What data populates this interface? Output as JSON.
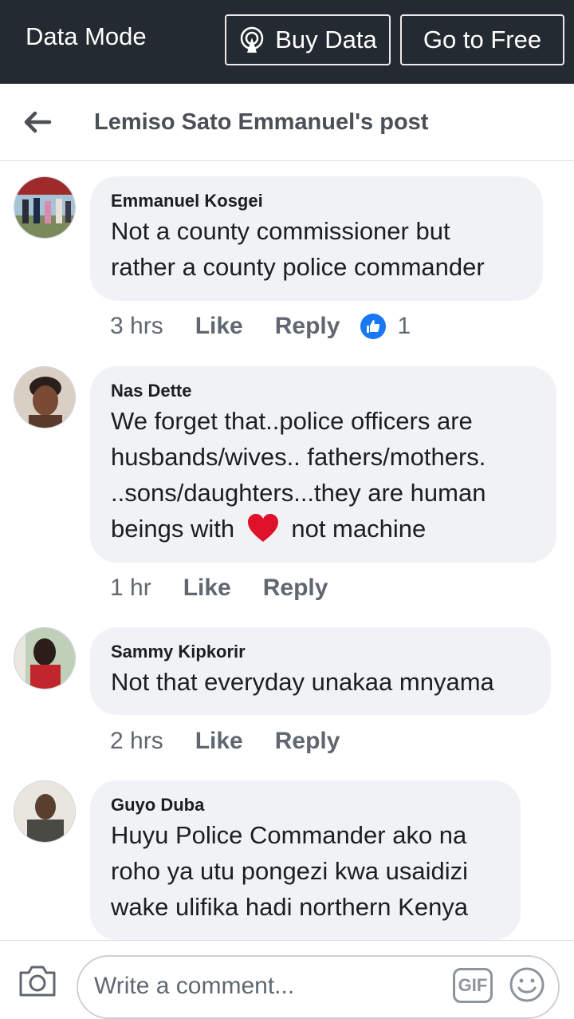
{
  "databar": {
    "mode_label": "Data Mode",
    "buy_label": "Buy Data",
    "free_label": "Go to Free"
  },
  "header": {
    "title": "Lemiso Sato Emmanuel's post"
  },
  "comments": [
    {
      "author": "Emmanuel Kosgei",
      "lines": [
        "Not a county commissioner but",
        "rather a county police commander"
      ],
      "time": "3 hrs",
      "like_label": "Like",
      "reply_label": "Reply",
      "reaction_count": "1"
    },
    {
      "author": "Nas Dette",
      "lines": [
        "We forget that..police officers are",
        "husbands/wives.. fathers/mothers.",
        "..sons/daughters...they are human",
        "beings with",
        "not machine"
      ],
      "time": "1 hr",
      "like_label": "Like",
      "reply_label": "Reply"
    },
    {
      "author": "Sammy Kipkorir",
      "lines": [
        "Not that everyday unakaa mnyama"
      ],
      "time": "2 hrs",
      "like_label": "Like",
      "reply_label": "Reply"
    },
    {
      "author": "Guyo Duba",
      "lines": [
        "Huyu Police Commander ako na",
        "roho ya utu pongezi kwa usaidizi",
        "wake ulifika hadi northern Kenya"
      ]
    }
  ],
  "composer": {
    "placeholder": "Write a comment...",
    "gif_label": "GIF"
  },
  "icons": {
    "buy": "broadcast-icon",
    "back": "back-arrow-icon",
    "like": "thumbs-up-icon",
    "heart": "heart-icon",
    "camera": "camera-icon",
    "emoji": "smiley-icon"
  },
  "colors": {
    "databar": "#242a31",
    "bubble": "#f0f2f5",
    "like_blue": "#1877f2",
    "heart_red": "#e0112b"
  }
}
